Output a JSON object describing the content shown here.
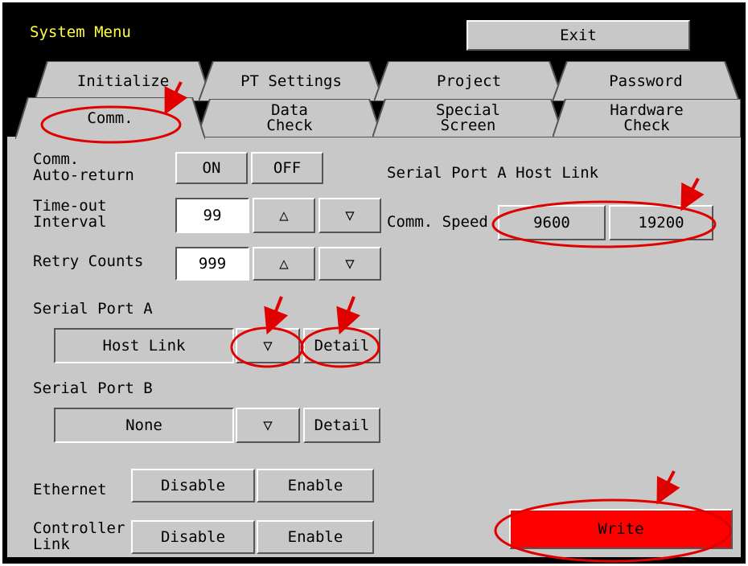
{
  "window": {
    "title": "System Menu",
    "exit_label": "Exit"
  },
  "tabs": {
    "back_row": [
      "Initialize",
      "PT Settings",
      "Project",
      "Password"
    ],
    "front_row": [
      {
        "label": "Comm.",
        "active": true
      },
      {
        "label": "Data\nCheck",
        "active": false
      },
      {
        "label": "Special\nScreen",
        "active": false
      },
      {
        "label": "Hardware\nCheck",
        "active": false
      }
    ]
  },
  "settings": {
    "auto_return": {
      "label": "Comm.\nAuto-return",
      "on_label": "ON",
      "off_label": "OFF"
    },
    "timeout": {
      "label": "Time-out\nInterval",
      "value": "99",
      "up": "△",
      "down": "▽"
    },
    "retry": {
      "label": "Retry Counts",
      "value": "999",
      "up": "△",
      "down": "▽"
    },
    "serial_a": {
      "label": "Serial Port A",
      "value": "Host Link",
      "dropdown": "▽",
      "detail": "Detail"
    },
    "serial_b": {
      "label": "Serial Port B",
      "value": "None",
      "dropdown": "▽",
      "detail": "Detail"
    },
    "ethernet": {
      "label": "Ethernet",
      "disable": "Disable",
      "enable": "Enable"
    },
    "controller_link": {
      "label": "Controller\nLink",
      "disable": "Disable",
      "enable": "Enable"
    }
  },
  "host_link": {
    "heading": "Serial Port A Host Link",
    "speed_label": "Comm. Speed",
    "speed_options": [
      "9600",
      "19200"
    ]
  },
  "write_label": "Write",
  "colors": {
    "screen_bg": "#000000",
    "panel": "#c8c8c8",
    "title": "#ffff3a",
    "write": "#ff0000",
    "annotation": "#e00000"
  }
}
